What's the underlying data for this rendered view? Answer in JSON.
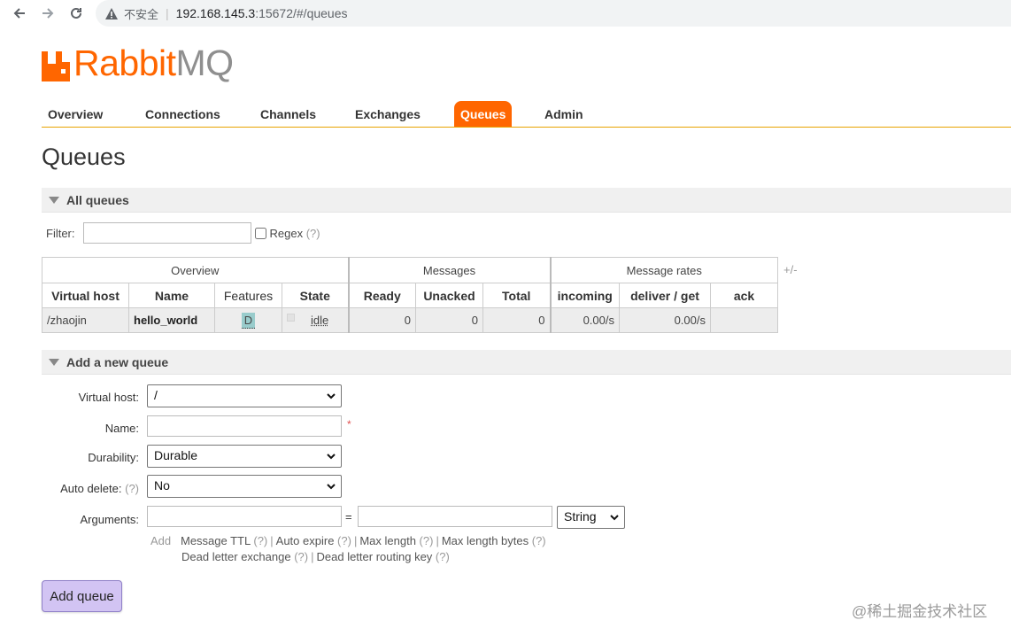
{
  "browser": {
    "insecure_label": "不安全",
    "url_host": "192.168.145.3",
    "url_rest": ":15672/#/queues"
  },
  "logo": {
    "rabbit": "Rabbit",
    "mq": "MQ"
  },
  "nav_tabs": [
    {
      "label": "Overview"
    },
    {
      "label": "Connections"
    },
    {
      "label": "Channels"
    },
    {
      "label": "Exchanges"
    },
    {
      "label": "Queues",
      "active": true
    },
    {
      "label": "Admin"
    }
  ],
  "page_title": "Queues",
  "all_queues": {
    "header": "All queues",
    "filter_label": "Filter:",
    "filter_value": "",
    "regex_label": "Regex",
    "regex_help": "(?)",
    "table": {
      "groups": [
        "Overview",
        "Messages",
        "Message rates"
      ],
      "plusminus": "+/-",
      "columns": [
        "Virtual host",
        "Name",
        "Features",
        "State",
        "Ready",
        "Unacked",
        "Total",
        "incoming",
        "deliver / get",
        "ack"
      ],
      "rows": [
        {
          "vhost": "/zhaojin",
          "name": "hello_world",
          "features": "D",
          "state": "idle",
          "ready": "0",
          "unacked": "0",
          "total": "0",
          "incoming": "0.00/s",
          "deliver_get": "0.00/s",
          "ack": ""
        }
      ]
    }
  },
  "add_queue": {
    "header": "Add a new queue",
    "virtual_host_label": "Virtual host:",
    "virtual_host_value": "/",
    "name_label": "Name:",
    "name_value": "",
    "required_mark": "*",
    "durability_label": "Durability:",
    "durability_value": "Durable",
    "auto_delete_label": "Auto delete:",
    "auto_delete_help": "(?)",
    "auto_delete_value": "No",
    "arguments_label": "Arguments:",
    "equals": "=",
    "arg_type_value": "String",
    "add_label": "Add",
    "arg_links_line1": [
      {
        "label": "Message TTL",
        "help": "(?)"
      },
      {
        "label": "Auto expire",
        "help": "(?)"
      },
      {
        "label": "Max length",
        "help": "(?)"
      },
      {
        "label": "Max length bytes",
        "help": "(?)"
      }
    ],
    "arg_links_line2": [
      {
        "label": "Dead letter exchange",
        "help": "(?)"
      },
      {
        "label": "Dead letter routing key",
        "help": "(?)"
      }
    ],
    "submit_label": "Add queue"
  },
  "watermark": "@稀土掘金技术社区",
  "colors": {
    "brand_orange": "#ff6600",
    "tab_underline": "#e8a300",
    "feature_badge": "#99cccc",
    "button_bg": "#d2c4f3"
  }
}
